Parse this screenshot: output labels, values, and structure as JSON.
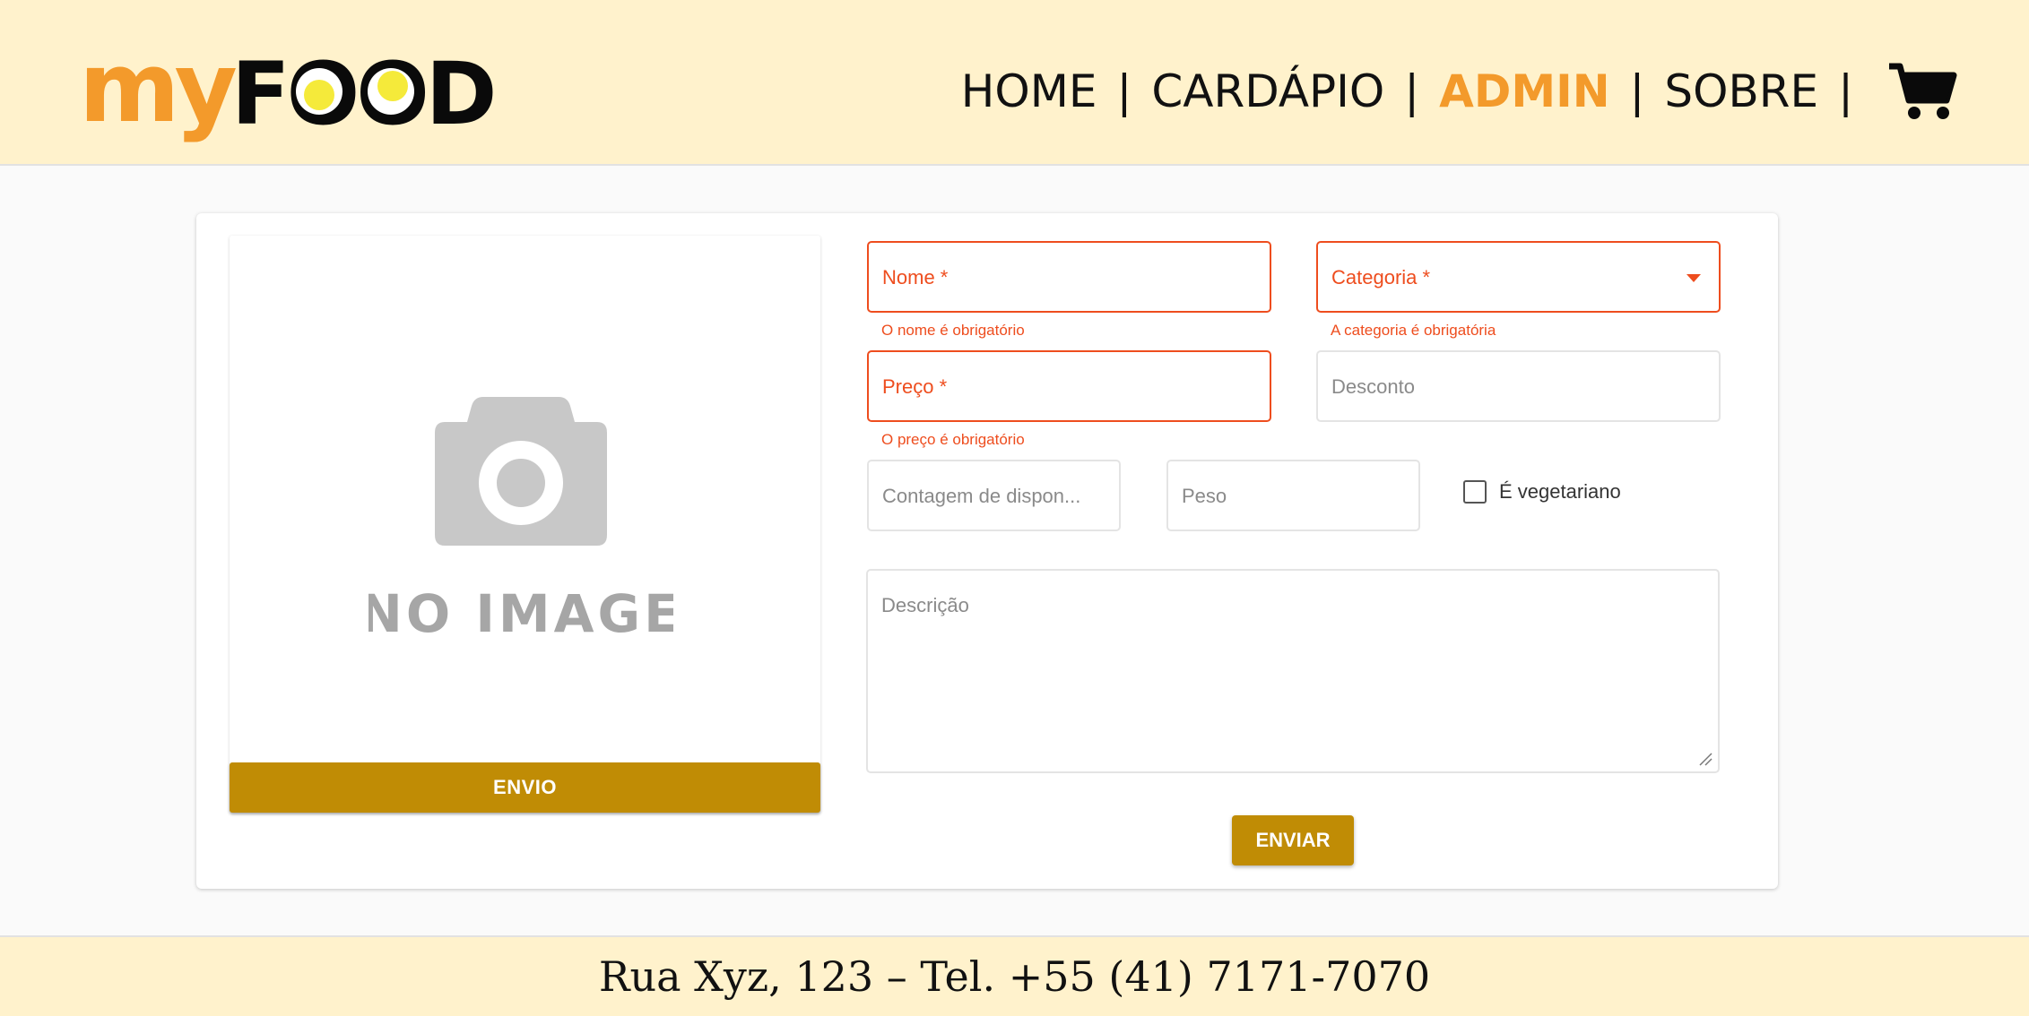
{
  "header": {
    "logo": {
      "text_my": "my",
      "text_food": "FOOD"
    },
    "nav": [
      {
        "label": "HOME",
        "active": false
      },
      {
        "label": "CARDÁPIO",
        "active": false
      },
      {
        "label": "ADMIN",
        "active": true
      },
      {
        "label": "SOBRE",
        "active": false
      }
    ],
    "separator": "|",
    "cart_icon": "shopping-cart-icon"
  },
  "image_panel": {
    "placeholder_text": "NO IMAGE",
    "upload_button": "ENVIO"
  },
  "form": {
    "nome": {
      "label": "Nome *",
      "error": "O nome é obrigatório"
    },
    "categoria": {
      "label": "Categoria *",
      "error": "A categoria é obrigatória"
    },
    "preco": {
      "label": "Preço *",
      "error": "O preço é obrigatório"
    },
    "desconto": {
      "label": "Desconto"
    },
    "contagem": {
      "label": "Contagem de dispon..."
    },
    "peso": {
      "label": "Peso"
    },
    "vegetariano": {
      "label": "É vegetariano",
      "checked": false
    },
    "descricao": {
      "label": "Descrição"
    },
    "submit": "ENVIAR"
  },
  "footer": {
    "text": "Rua Xyz, 123 – Tel. +55 (41) 7171-7070"
  },
  "colors": {
    "header_bg": "#fff2cc",
    "accent_orange": "#f39a2b",
    "button_gold": "#c08c05",
    "error_red": "#ee4d1e"
  }
}
